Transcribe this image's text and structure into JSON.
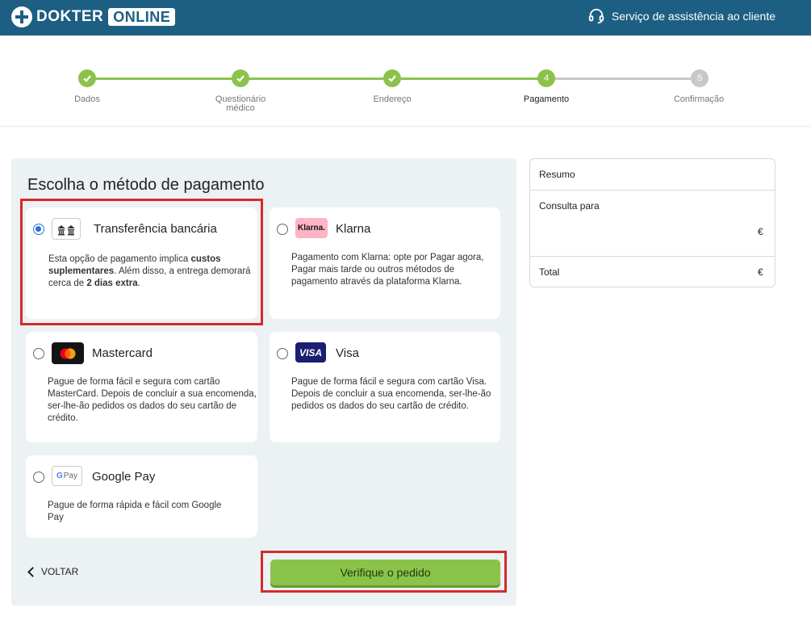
{
  "header": {
    "logo_word1": "DOKTER",
    "logo_word2": "ONLINE",
    "support_label": "Serviço de assistência ao cliente",
    "support_icon": "headset-icon",
    "brand_color": "#1d5f83"
  },
  "stepper": {
    "steps": [
      {
        "label": "Dados",
        "state": "done"
      },
      {
        "label": "Questionário médico",
        "state": "done"
      },
      {
        "label": "Endereço",
        "state": "done"
      },
      {
        "label": "Pagamento",
        "number": "4",
        "state": "active"
      },
      {
        "label": "Confirmação",
        "number": "5",
        "state": "pending"
      }
    ],
    "done_color": "#8bc34a",
    "pending_color": "#c8c8c8"
  },
  "payment": {
    "title": "Escolha o método de pagamento",
    "methods": [
      {
        "name": "Transferência bancária",
        "icon": "bank-icon",
        "selected": true,
        "desc_1": "Esta opção de pagamento implica ",
        "desc_bold_1": "custos suplementares",
        "desc_2": ". Além disso, a entrega demorará cerca de ",
        "desc_bold_2": "2 dias extra",
        "desc_3": "."
      },
      {
        "name": "Klarna",
        "icon": "klarna-logo",
        "logo_text": "Klarna.",
        "selected": false,
        "desc": "Pagamento com Klarna: opte por Pagar agora, Pagar mais tarde ou outros métodos de pagamento através da plataforma Klarna."
      },
      {
        "name": "Mastercard",
        "icon": "mastercard-logo",
        "selected": false,
        "desc": "Pague de forma fácil e segura com cartão MasterCard. Depois de concluir a sua encomenda, ser-lhe-ão pedidos os dados do seu cartão de crédito."
      },
      {
        "name": "Visa",
        "icon": "visa-logo",
        "logo_text": "VISA",
        "selected": false,
        "desc": "Pague de forma fácil e segura com cartão Visa. Depois de concluir a sua encomenda, ser-lhe-ão pedidos os dados do seu cartão de crédito."
      },
      {
        "name": "Google Pay",
        "icon": "google-pay-logo",
        "logo_text_g": "G",
        "logo_text_pay": "Pay",
        "selected": false,
        "desc": "Pague de forma rápida e fácil com Google Pay"
      }
    ],
    "back_label": "VOLTAR",
    "verify_label": "Verifique o pedido",
    "button_color": "#8bc34a",
    "highlight_color": "#d42a2a"
  },
  "summary": {
    "title": "Resumo",
    "consult_label": "Consulta para",
    "consult_value": "€",
    "total_label": "Total",
    "total_value": "€"
  }
}
